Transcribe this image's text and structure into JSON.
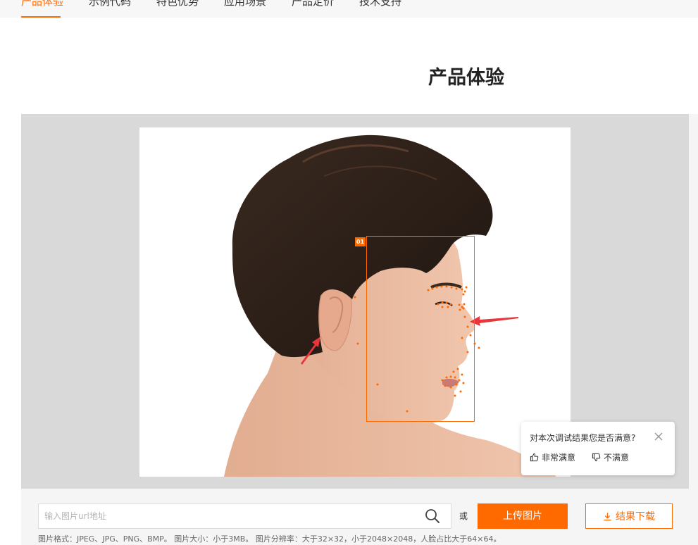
{
  "nav": {
    "items": [
      {
        "label": "产品体验"
      },
      {
        "label": "示例代码"
      },
      {
        "label": "特色优势"
      },
      {
        "label": "应用场景"
      },
      {
        "label": "产品定价"
      },
      {
        "label": "技术支持"
      }
    ],
    "active_index": 0
  },
  "section": {
    "title": "产品体验"
  },
  "result": {
    "face_label": "01",
    "box_color": "#ff6a00",
    "arrow_color": "#e8363a"
  },
  "feedback": {
    "question": "对本次调试结果您是否满意?",
    "positive_label": "非常满意",
    "negative_label": "不满意"
  },
  "controls": {
    "url_placeholder": "输入图片url地址",
    "or_label": "或",
    "upload_label": "上传图片",
    "download_label": "结果下载",
    "spec_text": "图片格式：JPEG、JPG、PNG、BMP。 图片大小：小于3MB。 图片分辨率：大于32×32，小于2048×2048，人脸占比大于64×64。"
  },
  "colors": {
    "accent": "#ff6a00"
  }
}
